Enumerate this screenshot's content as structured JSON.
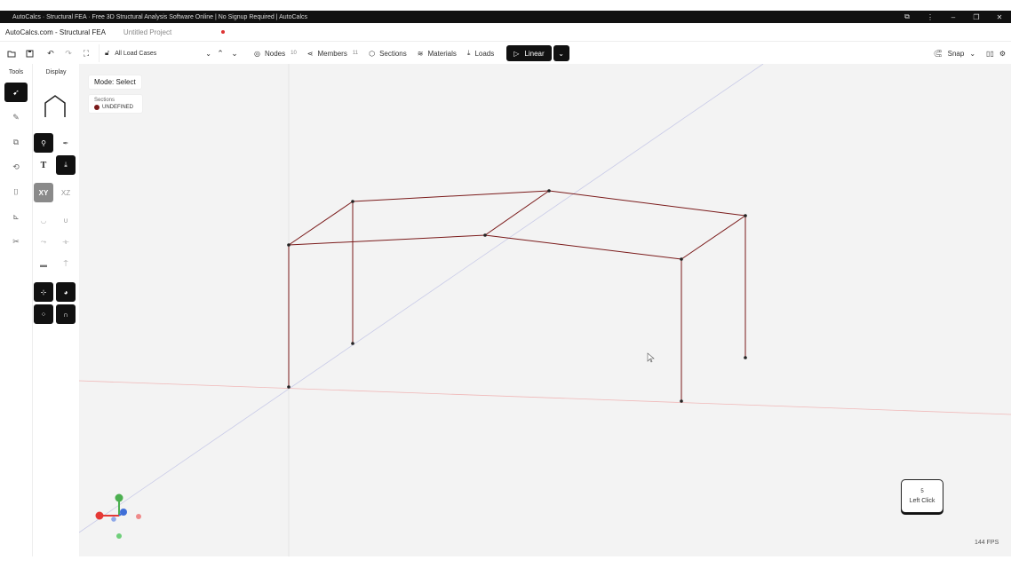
{
  "window": {
    "title": "AutoCalcs · Structural FEA · Free 3D Structural Analysis Software Online | No Signup Required | AutoCalcs",
    "controls": {
      "min": "–",
      "max": "❐",
      "close": "✕"
    }
  },
  "app": {
    "name": "AutoCalcs.com - Structural FEA",
    "project": "Untitled Project"
  },
  "toolbar": {
    "load_case": "All Load Cases",
    "nodes_label": "Nodes",
    "nodes_count": "10",
    "members_label": "Members",
    "members_count": "11",
    "sections_label": "Sections",
    "materials_label": "Materials",
    "loads_label": "Loads",
    "analysis_label": "Linear",
    "snap_label": "Snap"
  },
  "sidebar": {
    "tools_header": "Tools",
    "display_header": "Display"
  },
  "display": {
    "text_tool": "T",
    "plane_xy": "XY",
    "plane_xz": "XZ"
  },
  "overlay": {
    "mode": "Mode: Select",
    "sections_title": "Sections",
    "section_item": "UNDEFINED",
    "section_color": "#7a1a1a"
  },
  "hint": {
    "key": "5",
    "action": "Left Click"
  },
  "status": {
    "fps": "144 FPS"
  },
  "colors": {
    "member": "#7a1a1a",
    "node": "#222222",
    "axis_x": "#e57373",
    "axis_y": "#4caf50",
    "axis_z": "#3f6fd8"
  }
}
